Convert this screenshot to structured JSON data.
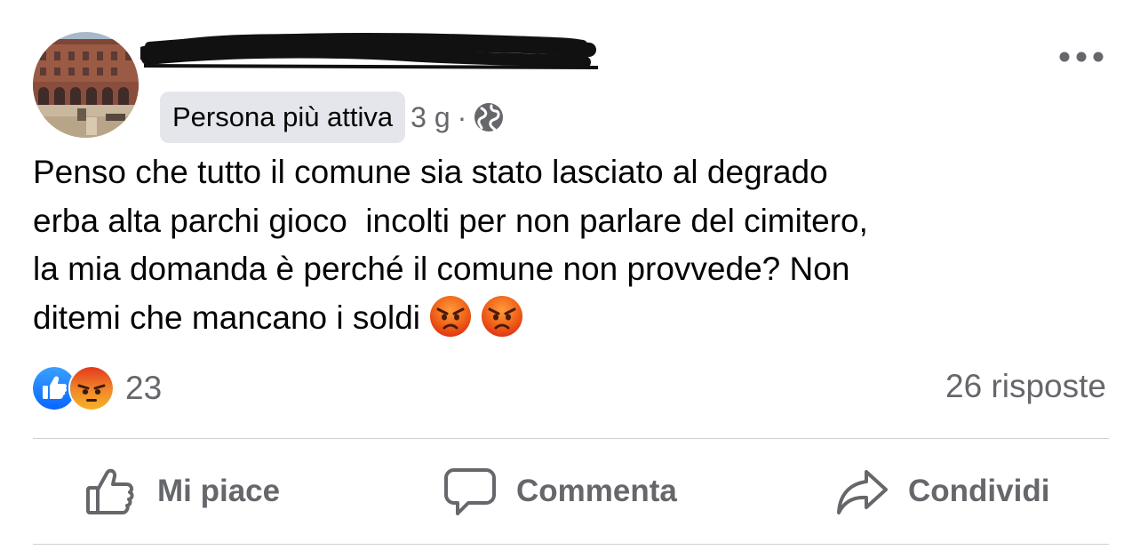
{
  "post": {
    "badge": "Persona più attiva",
    "time": "3 g",
    "separator": "·",
    "icons": {
      "more": "more-horizontal-icon",
      "privacy": "globe-icon"
    },
    "text_lines": [
      "Penso che tutto il comune sia stato lasciato al degrado",
      "erba alta parchi gioco  incolti per non parlare del cimitero,",
      "la mia domanda è perché il comune non provvede? Non",
      "ditemi che mancano i soldi"
    ],
    "text_emojis": [
      "angry-face-emoji",
      "angry-face-emoji"
    ]
  },
  "reactions": {
    "types": [
      "like",
      "angry"
    ],
    "count": "23"
  },
  "replies": "26 risposte",
  "actions": {
    "like": "Mi piace",
    "comment": "Commenta",
    "share": "Condividi"
  },
  "colors": {
    "text": "#050505",
    "secondary": "#65676b",
    "badge_bg": "#e4e6eb",
    "divider": "#ced0d4",
    "like_blue": "#1877f2",
    "angry_orange": "#f08a24"
  }
}
